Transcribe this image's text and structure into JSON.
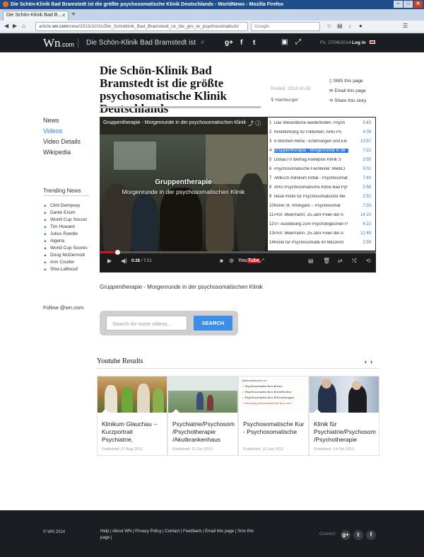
{
  "browser": {
    "window_title": "Die Schön-Klinik Bad Bramstedt ist die größte psychosomatische Klinik Deutschlands - WorldNews - Mozilla Firefox",
    "tab_label": "Die Schön-Klinik Bad B...",
    "url_prefix": "article.",
    "url_domain": "wn.com",
    "url_rest": "/view/2013/10/31/Die_Schnklinik_Bad_Bramstedt_ist_die_gro_te_psychosomatisch/",
    "search_placeholder": "Google"
  },
  "header": {
    "logo_main": "Wn",
    "logo_suffix": ".com",
    "title": "Die Schön-Klinik Bad Bramstedt ist",
    "social": [
      "g+",
      "f",
      "t"
    ],
    "date": "Fri, 27/06/2014",
    "login": "Log in"
  },
  "article": {
    "title": "Die Schön-Klinik Bad Bramstedt ist die größte psychosomatische Klinik Deutschlands",
    "posted": "Posted, 2013-10-31",
    "location": "Hamburger",
    "share": [
      "SMS this page",
      "Email this page",
      "Share this story"
    ]
  },
  "left_nav": {
    "items": [
      "News",
      "Videos",
      "Video Details",
      "Wikipedia"
    ],
    "active": "Videos"
  },
  "trending": {
    "title": "Trending News",
    "items": [
      "Clint Dempsey",
      "Dante Exum",
      "World Cup Soccer",
      "Tim Howard",
      "Julius Randle",
      "Algeria",
      "World Cup Scores",
      "Doug McDermott",
      "Ann Coulter",
      "Shia LaBeouf"
    ]
  },
  "follow": "Follow @wn.com",
  "player": {
    "video_title": "Gruppentherapie - Morgenrunde in der psychosomatischen Klinik",
    "caption_line1": "Gruppentherapie",
    "caption_line2": "Morgenrunde in der psychosomatischen Klinik",
    "time_current": "0:28",
    "time_total": "/ 7:21",
    "progress": 0.064,
    "playlist": [
      {
        "n": "1",
        "title": "Das Wesentliche wiederfinden. Psych",
        "time": "5:43"
      },
      {
        "n": "2",
        "title": "Klinikführung für Patienten: AHG Ps",
        "time": "4:09"
      },
      {
        "n": "3",
        "title": "6 Wochen Reha - Erfahrungen und Ein",
        "time": "13:57"
      },
      {
        "n": "4",
        "title": "Gruppentherapie - Morgenrunde in de",
        "time": "7:22"
      },
      {
        "n": "5",
        "title": "DonauTV Beitrag Asklepios Klinik S",
        "time": "3:55"
      },
      {
        "n": "6",
        "title": "Psychosomatische Fachklinik: MediCl",
        "time": "5:02"
      },
      {
        "n": "7",
        "title": "AMEOS Klinikum Inntal - Psychosomat",
        "time": "7:44"
      },
      {
        "n": "8",
        "title": "AHG Psychosomatische Klinik Bad Pyr",
        "time": "2:56"
      },
      {
        "n": "9",
        "title": "Neue Klinik für Psychosomatische Me",
        "time": "2:52"
      },
      {
        "n": "10",
        "title": "Klinik St. Irmingard -- Psychosomat",
        "time": "7:33"
      },
      {
        "n": "11",
        "title": "Prof. Meermann: 25-Jahr-Feier der A",
        "time": "14:10"
      },
      {
        "n": "12",
        "title": "VT Ausbildung zum Psychologischen P",
        "time": "4:22"
      },
      {
        "n": "13",
        "title": "Prof. Meermann: 25-Jahr-Feier der A",
        "time": "12:49"
      },
      {
        "n": "14",
        "title": "Klinik für Psychosomatik im MEDIAN",
        "time": "2:59"
      }
    ],
    "current_index": 3
  },
  "video_caption": "Gruppentherapie - Morgenrunde in der psychosomatischen Klinik",
  "more_search": {
    "placeholder": "Search for more videos...",
    "button": "SEARCH"
  },
  "youtube": {
    "title": "Youtube Results",
    "cards": [
      {
        "title": "Klinikum Glauchau -- Kurzportrait Psychiatrie,",
        "date": "Published: 27 Aug 2012"
      },
      {
        "title": "Psychiatrie/Psychosom /Psychotherapie /Akutkrankenhaus",
        "date": "Published: 11 Oct 2013"
      },
      {
        "title": "Psychosomatische Kur - Psychosomatische",
        "date": "Published: 10 Jan 2012"
      },
      {
        "title": "Klinik für Psychiatrie/Psychosom /Psychotherapie",
        "date": "Published: 14 Oct 2013"
      }
    ],
    "thumb3_lines": [
      "Informationen zu:",
      "Psychosomatischen Kuren",
      "Psychosomatischen Krankheiten",
      "Psychosomatischen Erkrankungen",
      "→ www.psychosomatische-kur.com"
    ]
  },
  "footer": {
    "copyright": "© WN 2014",
    "links": "Help | About WN | Privacy Policy | Contact | Feedback | Email this page | Sms this page |",
    "connect": "Connect:",
    "social": [
      "g+",
      "t",
      "f"
    ]
  },
  "colors": {
    "accent": "#2a7ae2",
    "header_bg": "#1a1d22",
    "progress": "#cc181e"
  }
}
